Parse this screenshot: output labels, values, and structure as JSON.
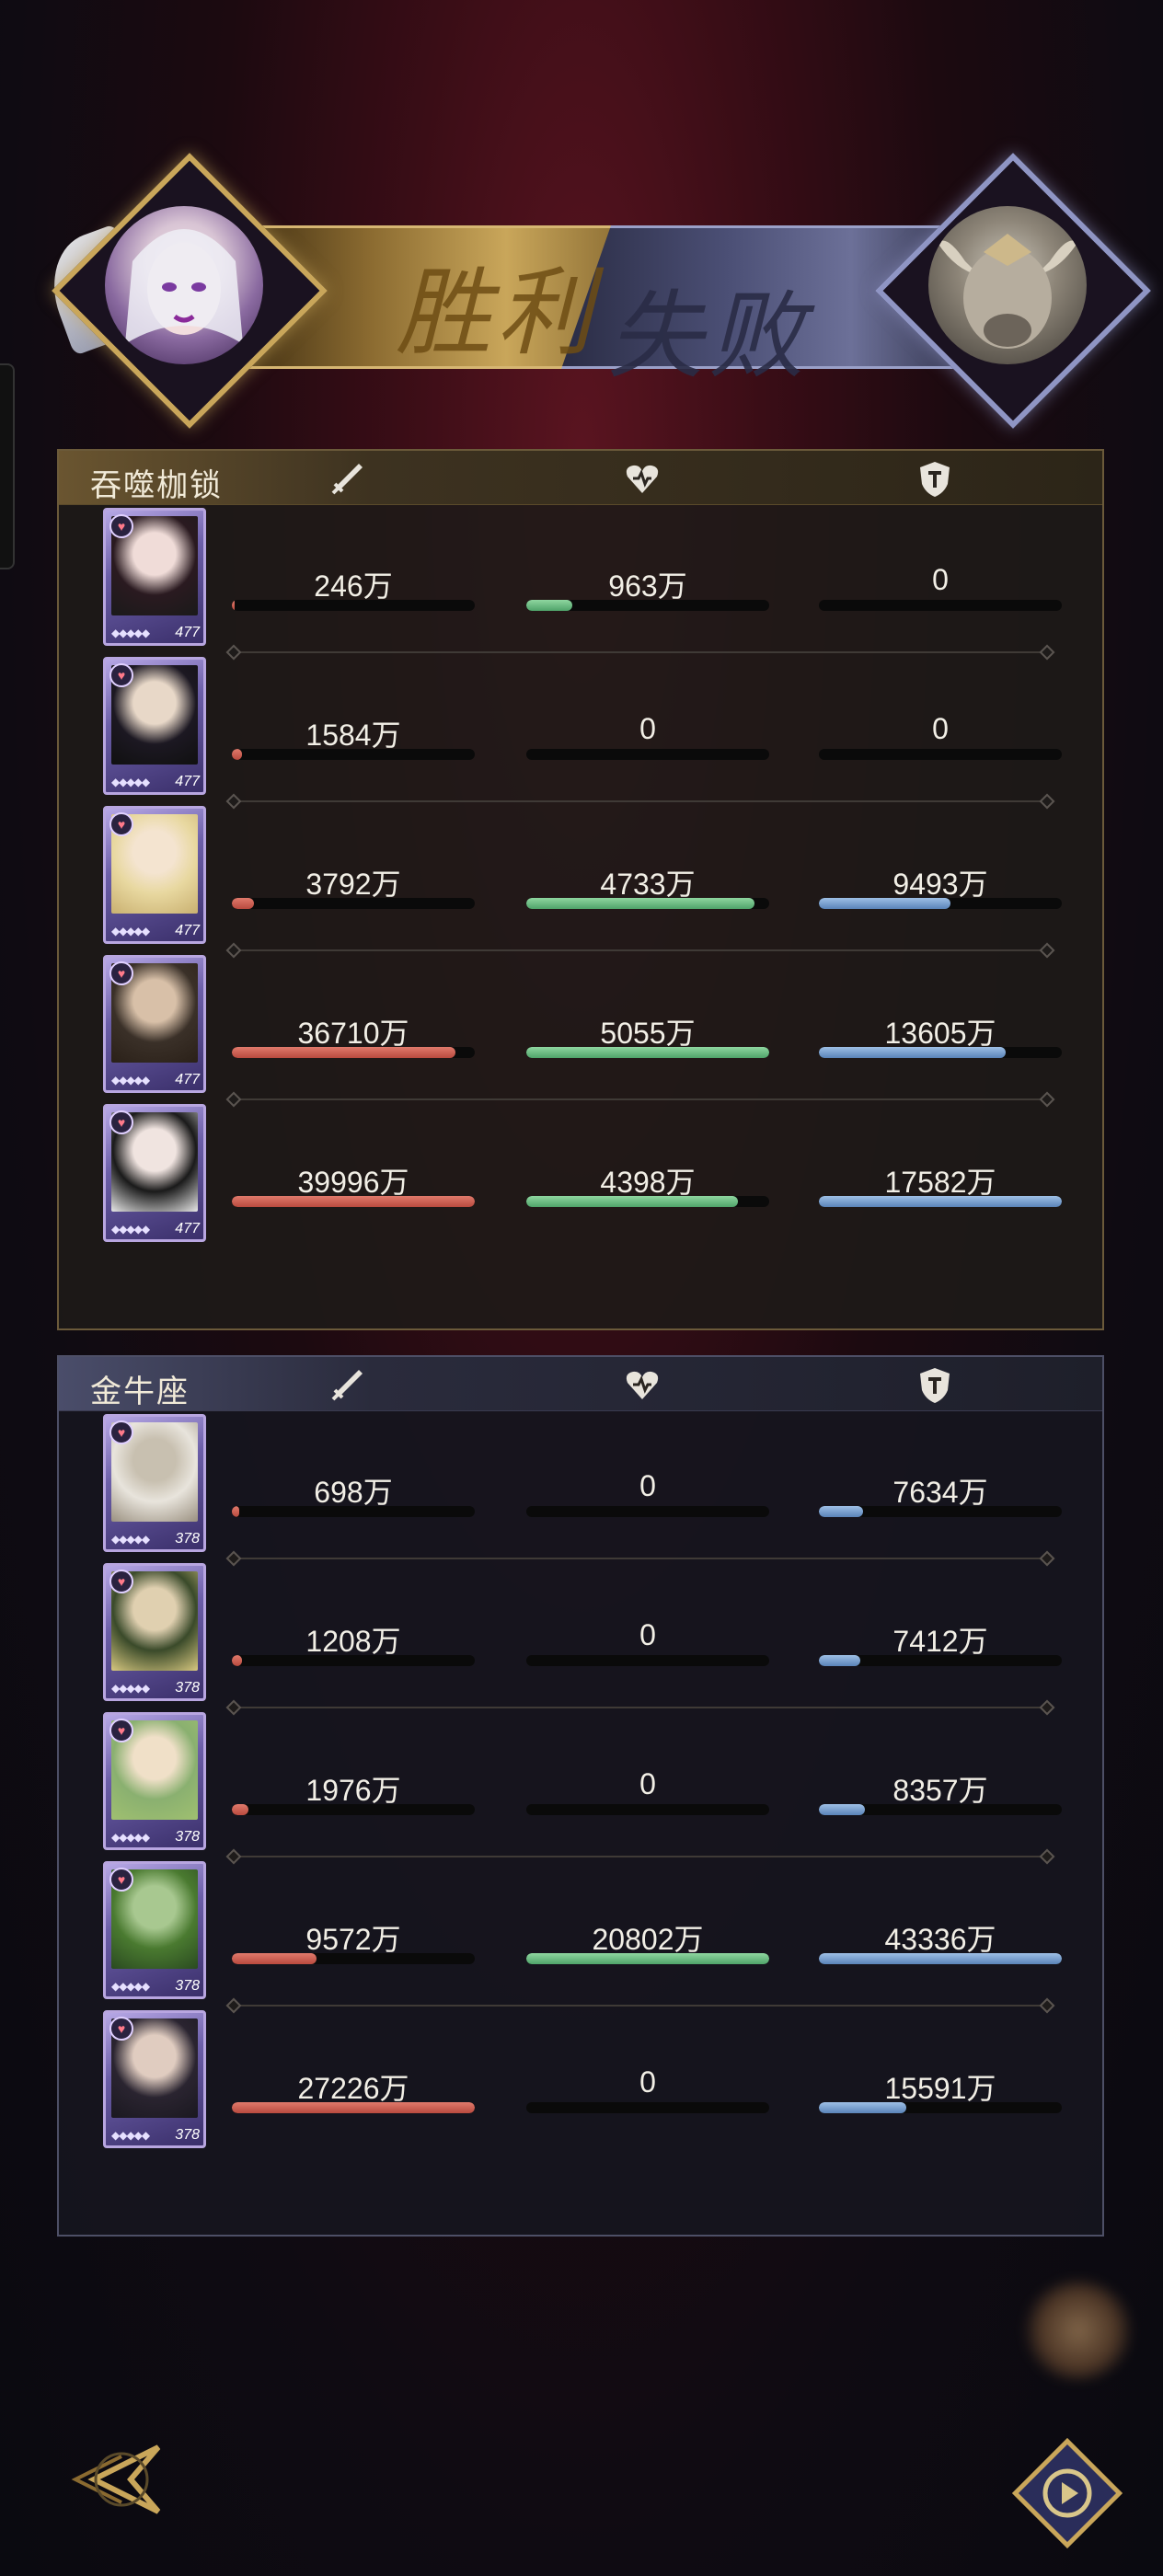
{
  "banner": {
    "win_label": "胜利",
    "lose_label": "失败",
    "colors": {
      "win_gold": "#c9a65a",
      "lose_blue": "#8f95c4"
    }
  },
  "columns": {
    "attack_icon": "sword-icon",
    "heal_icon": "heart-icon",
    "tank_icon": "shield-icon"
  },
  "teams": [
    {
      "name": "吞噬枷锁",
      "heroes": [
        {
          "level": "477",
          "damage": "246万",
          "damage_pct": 0.01,
          "healing": "963万",
          "healing_pct": 0.19,
          "taken": "0",
          "taken_pct": 0
        },
        {
          "level": "477",
          "damage": "1584万",
          "damage_pct": 0.04,
          "healing": "0",
          "healing_pct": 0,
          "taken": "0",
          "taken_pct": 0
        },
        {
          "level": "477",
          "damage": "3792万",
          "damage_pct": 0.09,
          "healing": "4733万",
          "healing_pct": 0.94,
          "taken": "9493万",
          "taken_pct": 0.54
        },
        {
          "level": "477",
          "damage": "36710万",
          "damage_pct": 0.92,
          "healing": "5055万",
          "healing_pct": 1.0,
          "taken": "13605万",
          "taken_pct": 0.77
        },
        {
          "level": "477",
          "damage": "39996万",
          "damage_pct": 1.0,
          "healing": "4398万",
          "healing_pct": 0.87,
          "taken": "17582万",
          "taken_pct": 1.0
        }
      ]
    },
    {
      "name": "金牛座",
      "heroes": [
        {
          "level": "378",
          "damage": "698万",
          "damage_pct": 0.03,
          "healing": "0",
          "healing_pct": 0,
          "taken": "7634万",
          "taken_pct": 0.18
        },
        {
          "level": "378",
          "damage": "1208万",
          "damage_pct": 0.04,
          "healing": "0",
          "healing_pct": 0,
          "taken": "7412万",
          "taken_pct": 0.17
        },
        {
          "level": "378",
          "damage": "1976万",
          "damage_pct": 0.07,
          "healing": "0",
          "healing_pct": 0,
          "taken": "8357万",
          "taken_pct": 0.19
        },
        {
          "level": "378",
          "damage": "9572万",
          "damage_pct": 0.35,
          "healing": "20802万",
          "healing_pct": 1.0,
          "taken": "43336万",
          "taken_pct": 1.0
        },
        {
          "level": "378",
          "damage": "27226万",
          "damage_pct": 1.0,
          "healing": "0",
          "healing_pct": 0,
          "taken": "15591万",
          "taken_pct": 0.36
        }
      ]
    }
  ]
}
